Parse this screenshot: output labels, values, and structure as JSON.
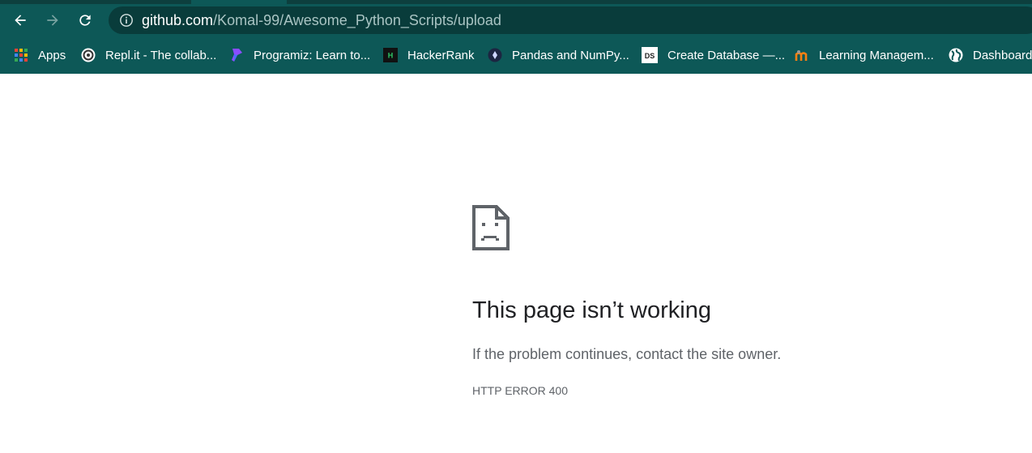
{
  "toolbar": {
    "url_host": "github.com",
    "url_path": "/Komal-99/Awesome_Python_Scripts/upload"
  },
  "bookmarks": [
    {
      "label": "Apps",
      "icon": "apps-grid-icon"
    },
    {
      "label": "Repl.it - The collab...",
      "icon": "replit-icon"
    },
    {
      "label": "Programiz: Learn to...",
      "icon": "programiz-icon"
    },
    {
      "label": "HackerRank",
      "icon": "hackerrank-icon"
    },
    {
      "label": "Pandas and NumPy...",
      "icon": "pandas-icon"
    },
    {
      "label": "Create Database —...",
      "icon": "ds-icon"
    },
    {
      "label": "Learning Managem...",
      "icon": "moodle-icon"
    },
    {
      "label": "Dashboard",
      "icon": "globe-icon"
    }
  ],
  "error": {
    "title": "This page isn’t working",
    "description": "If the problem continues, contact the site owner.",
    "code": "HTTP ERROR 400"
  },
  "colors": {
    "toolbar_bg": "#0d5857",
    "omnibox_bg": "#093c3b",
    "page_bg": "#ffffff",
    "title_text": "#202124",
    "secondary_text": "#5f6368"
  }
}
